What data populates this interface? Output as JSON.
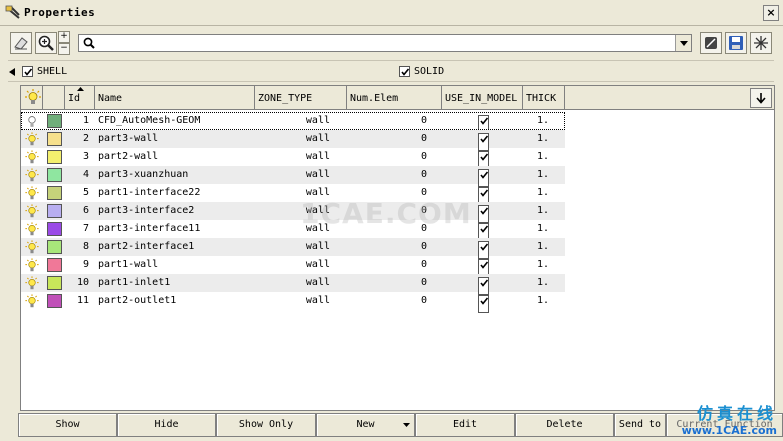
{
  "window": {
    "title": "Properties",
    "close_label": "×"
  },
  "search": {
    "value": "",
    "placeholder": ""
  },
  "filters": [
    {
      "label": "SHELL",
      "checked": true
    },
    {
      "label": "SOLID",
      "checked": true
    }
  ],
  "columns": [
    "Id",
    "Name",
    "ZONE_TYPE",
    "Num.Elem",
    "USE_IN_MODEL",
    "THICK"
  ],
  "rows": [
    {
      "id": "1",
      "name": "CFD_AutoMesh-GEOM",
      "zone": "wall",
      "num": "0",
      "use": true,
      "thick": "1.",
      "color": "#6fae7a",
      "lit": false
    },
    {
      "id": "2",
      "name": "part3-wall",
      "zone": "wall",
      "num": "0",
      "use": true,
      "thick": "1.",
      "color": "#f6e08c",
      "lit": true
    },
    {
      "id": "3",
      "name": "part2-wall",
      "zone": "wall",
      "num": "0",
      "use": true,
      "thick": "1.",
      "color": "#f4f06e",
      "lit": true
    },
    {
      "id": "4",
      "name": "part3-xuanzhuan",
      "zone": "wall",
      "num": "0",
      "use": true,
      "thick": "1.",
      "color": "#8fe6a0",
      "lit": true
    },
    {
      "id": "5",
      "name": "part1-interface22",
      "zone": "wall",
      "num": "0",
      "use": true,
      "thick": "1.",
      "color": "#c6d27a",
      "lit": true
    },
    {
      "id": "6",
      "name": "part3-interface2",
      "zone": "wall",
      "num": "0",
      "use": true,
      "thick": "1.",
      "color": "#b8aef0",
      "lit": true
    },
    {
      "id": "7",
      "name": "part3-interface11",
      "zone": "wall",
      "num": "0",
      "use": true,
      "thick": "1.",
      "color": "#9a4ae6",
      "lit": true
    },
    {
      "id": "8",
      "name": "part2-interface1",
      "zone": "wall",
      "num": "0",
      "use": true,
      "thick": "1.",
      "color": "#a8e67a",
      "lit": true
    },
    {
      "id": "9",
      "name": "part1-wall",
      "zone": "wall",
      "num": "0",
      "use": true,
      "thick": "1.",
      "color": "#f07898",
      "lit": true
    },
    {
      "id": "10",
      "name": "part1-inlet1",
      "zone": "wall",
      "num": "0",
      "use": true,
      "thick": "1.",
      "color": "#c8e65a",
      "lit": true
    },
    {
      "id": "11",
      "name": "part2-outlet1",
      "zone": "wall",
      "num": "0",
      "use": true,
      "thick": "1.",
      "color": "#c050b8",
      "lit": true
    }
  ],
  "buttons": [
    "Show",
    "Hide",
    "Show Only",
    "New",
    "Edit",
    "Delete",
    "Send to",
    "Current Function"
  ],
  "watermark": "1CAE.COM",
  "brand": {
    "cn": "仿真在线",
    "url": "www.1CAE.com"
  }
}
